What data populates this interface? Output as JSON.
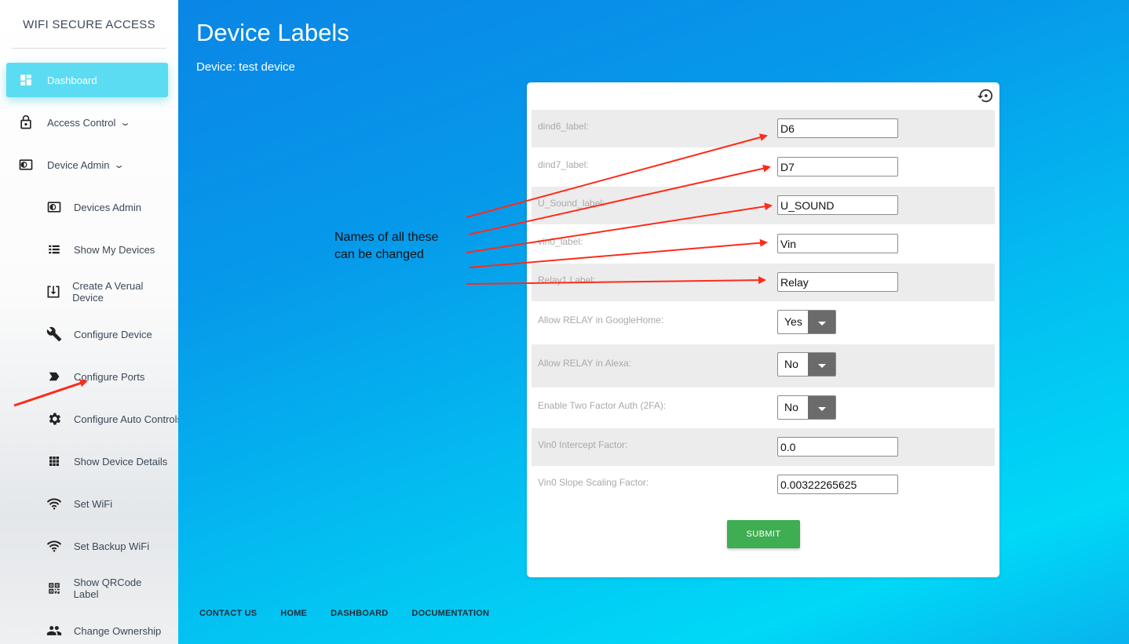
{
  "brand": "WIFI SECURE ACCESS",
  "sidebar": {
    "items": [
      {
        "label": "Dashboard",
        "icon": "dashboard-icon",
        "active": true
      },
      {
        "label": "Access Control",
        "icon": "lock-icon",
        "caret": true
      },
      {
        "label": "Device Admin",
        "icon": "device-admin-icon",
        "caret": true
      },
      {
        "label": "Devices Admin",
        "icon": "devices-admin-icon"
      },
      {
        "label": "Show My Devices",
        "icon": "list-icon"
      },
      {
        "label": "Create A Verual Device",
        "icon": "download-box-icon"
      },
      {
        "label": "Configure Device",
        "icon": "wrench-icon"
      },
      {
        "label": "Configure Ports",
        "icon": "label-tag-icon"
      },
      {
        "label": "Configure Auto Controls",
        "icon": "gear-icon"
      },
      {
        "label": "Show Device Details",
        "icon": "grid-icon"
      },
      {
        "label": "Set WiFi",
        "icon": "wifi-icon"
      },
      {
        "label": "Set Backup WiFi",
        "icon": "wifi-icon"
      },
      {
        "label": "Show QRCode Label",
        "icon": "qrcode-icon"
      },
      {
        "label": "Change Ownership",
        "icon": "people-icon"
      }
    ]
  },
  "main": {
    "title": "Device Labels",
    "subtitle": "Device: test device",
    "annotation_line1": "Names of all these",
    "annotation_line2": "can be changed"
  },
  "form": {
    "rows": [
      {
        "label": "dind6_label:",
        "value": "D6"
      },
      {
        "label": "dind7_label:",
        "value": "D7"
      },
      {
        "label": "U_Sound_label:",
        "value": "U_SOUND"
      },
      {
        "label": "vin0_label:",
        "value": "Vin"
      },
      {
        "label": "Relay1 Label:",
        "value": "Relay"
      },
      {
        "label": "Allow RELAY in GoogleHome:",
        "value": "Yes"
      },
      {
        "label": "Allow RELAY in Alexa:",
        "value": "No"
      },
      {
        "label": "Enable Two Factor Auth (2FA):",
        "value": "No"
      },
      {
        "label": "Vin0 Intercept Factor:",
        "value": "0.0"
      },
      {
        "label": "Vin0 Slope Scaling Factor:",
        "value": "0.00322265625"
      }
    ],
    "submit_label": "SUBMIT"
  },
  "footer": {
    "links": [
      "CONTACT US",
      "HOME",
      "DASHBOARD",
      "DOCUMENTATION"
    ]
  },
  "colors": {
    "accent": "#5bdcf2",
    "submit": "#3fad52",
    "arrow": "#ff2a1a"
  }
}
